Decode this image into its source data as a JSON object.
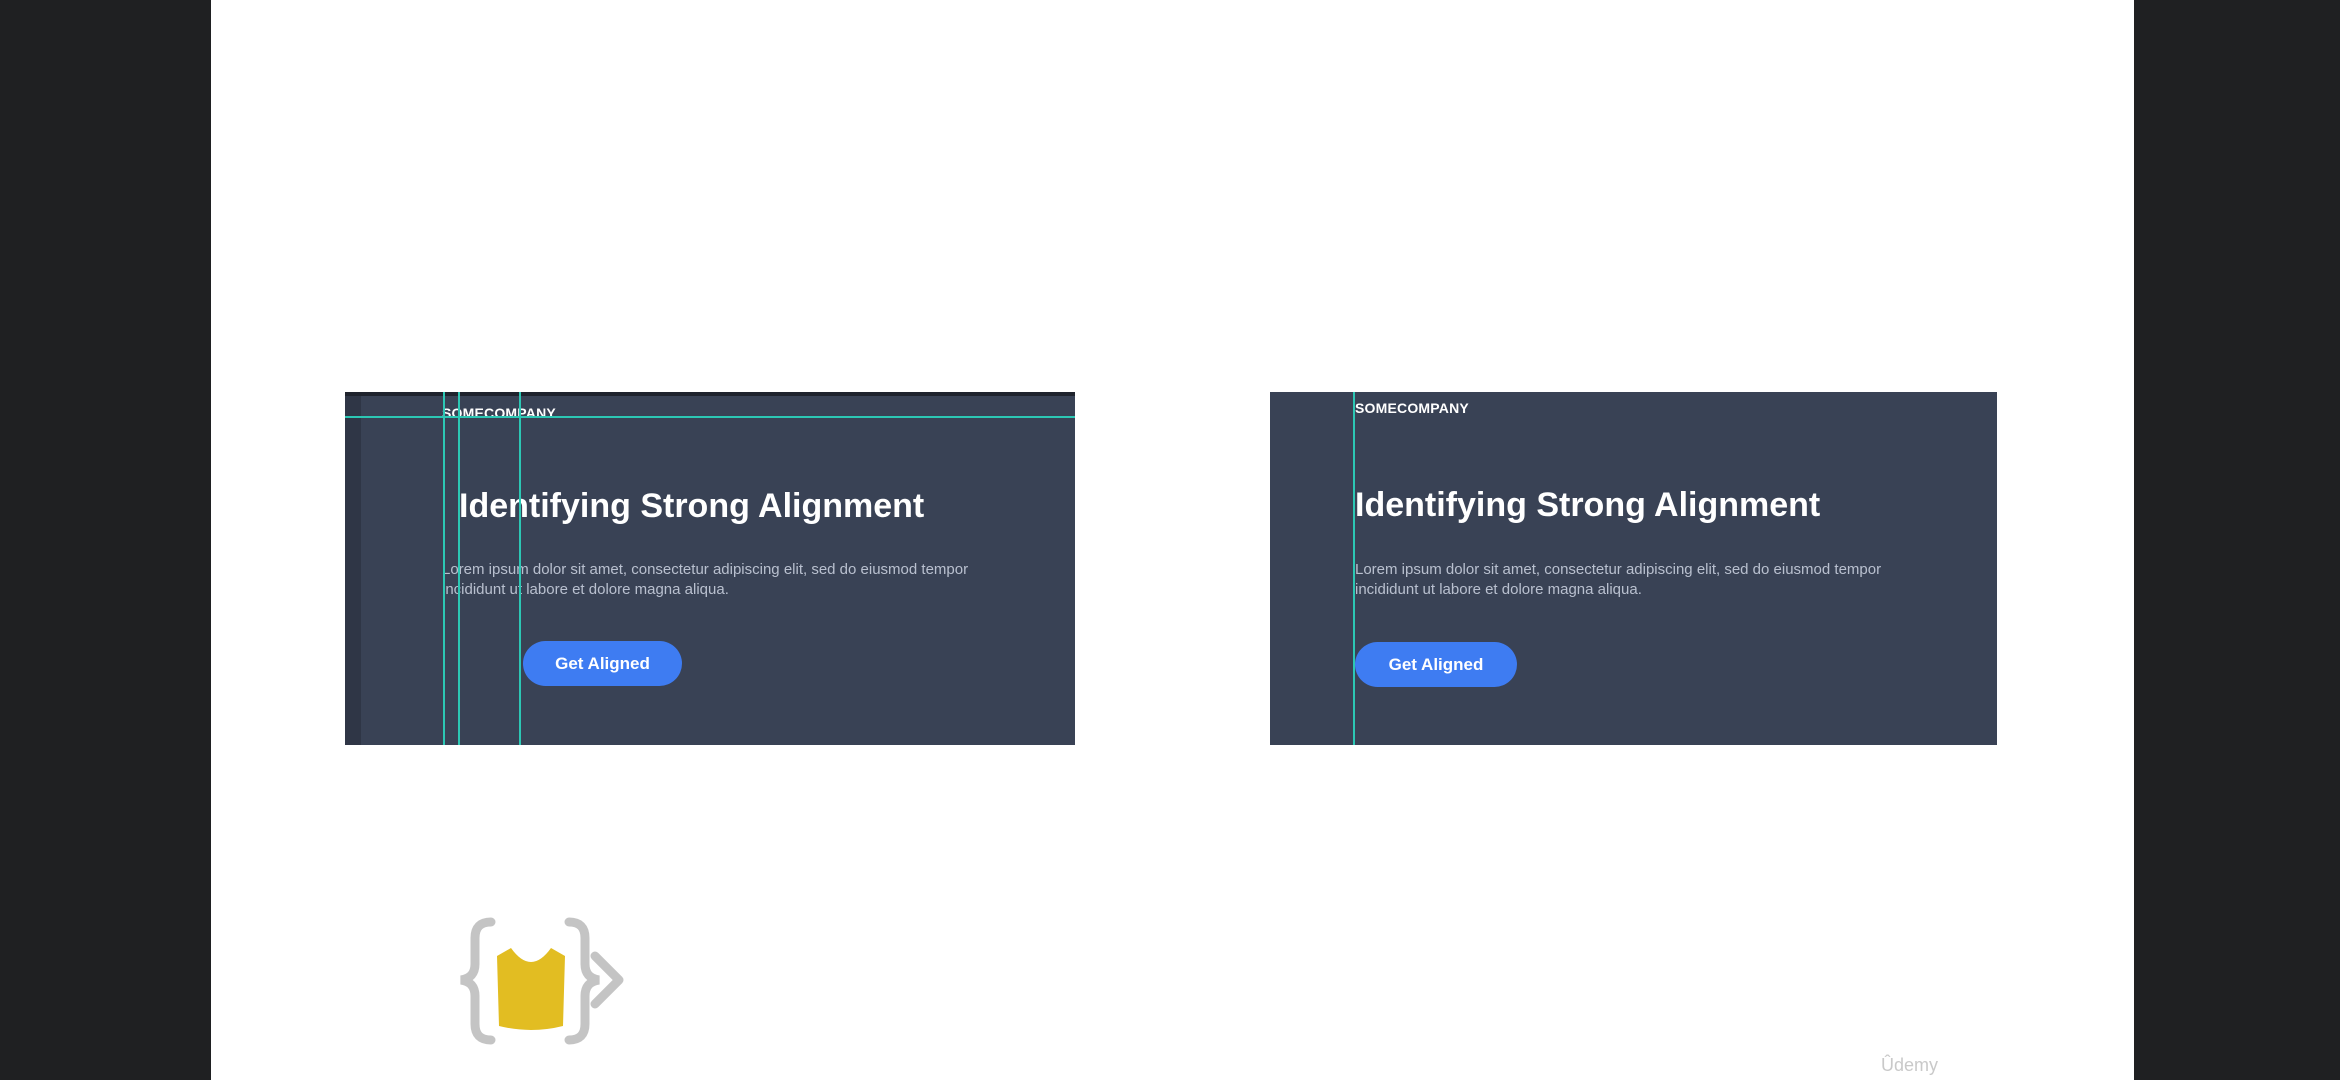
{
  "slide": {
    "left_mockup": {
      "brand": "SOMECOMPANY",
      "headline": "Identifying Strong Alignment",
      "body_line1": "Lorem ipsum dolor sit amet, consectetur adipiscing elit, sed do eiusmod tempor",
      "body_line2": "incididunt ut labore et dolore magna aliqua.",
      "button_label": "Get Aligned"
    },
    "right_mockup": {
      "brand": "SOMECOMPANY",
      "headline": "Identifying Strong Alignment",
      "body_line1": "Lorem ipsum dolor sit amet, consectetur adipiscing elit, sed do eiusmod tempor",
      "body_line2": "incididunt ut labore et dolore magna aliqua.",
      "button_label": "Get Aligned"
    },
    "logo_icon": "curly-braces-shirt-logo-icon",
    "watermark": "Ûdemy"
  },
  "colors": {
    "frame_background": "#1f2022",
    "slide_background": "#ffffff",
    "mockup_background": "#394255",
    "guide_line": "#2cc7b4",
    "button": "#3e7cf2",
    "logo_yellow": "#e2bd22",
    "logo_gray": "#c4c4c4"
  }
}
